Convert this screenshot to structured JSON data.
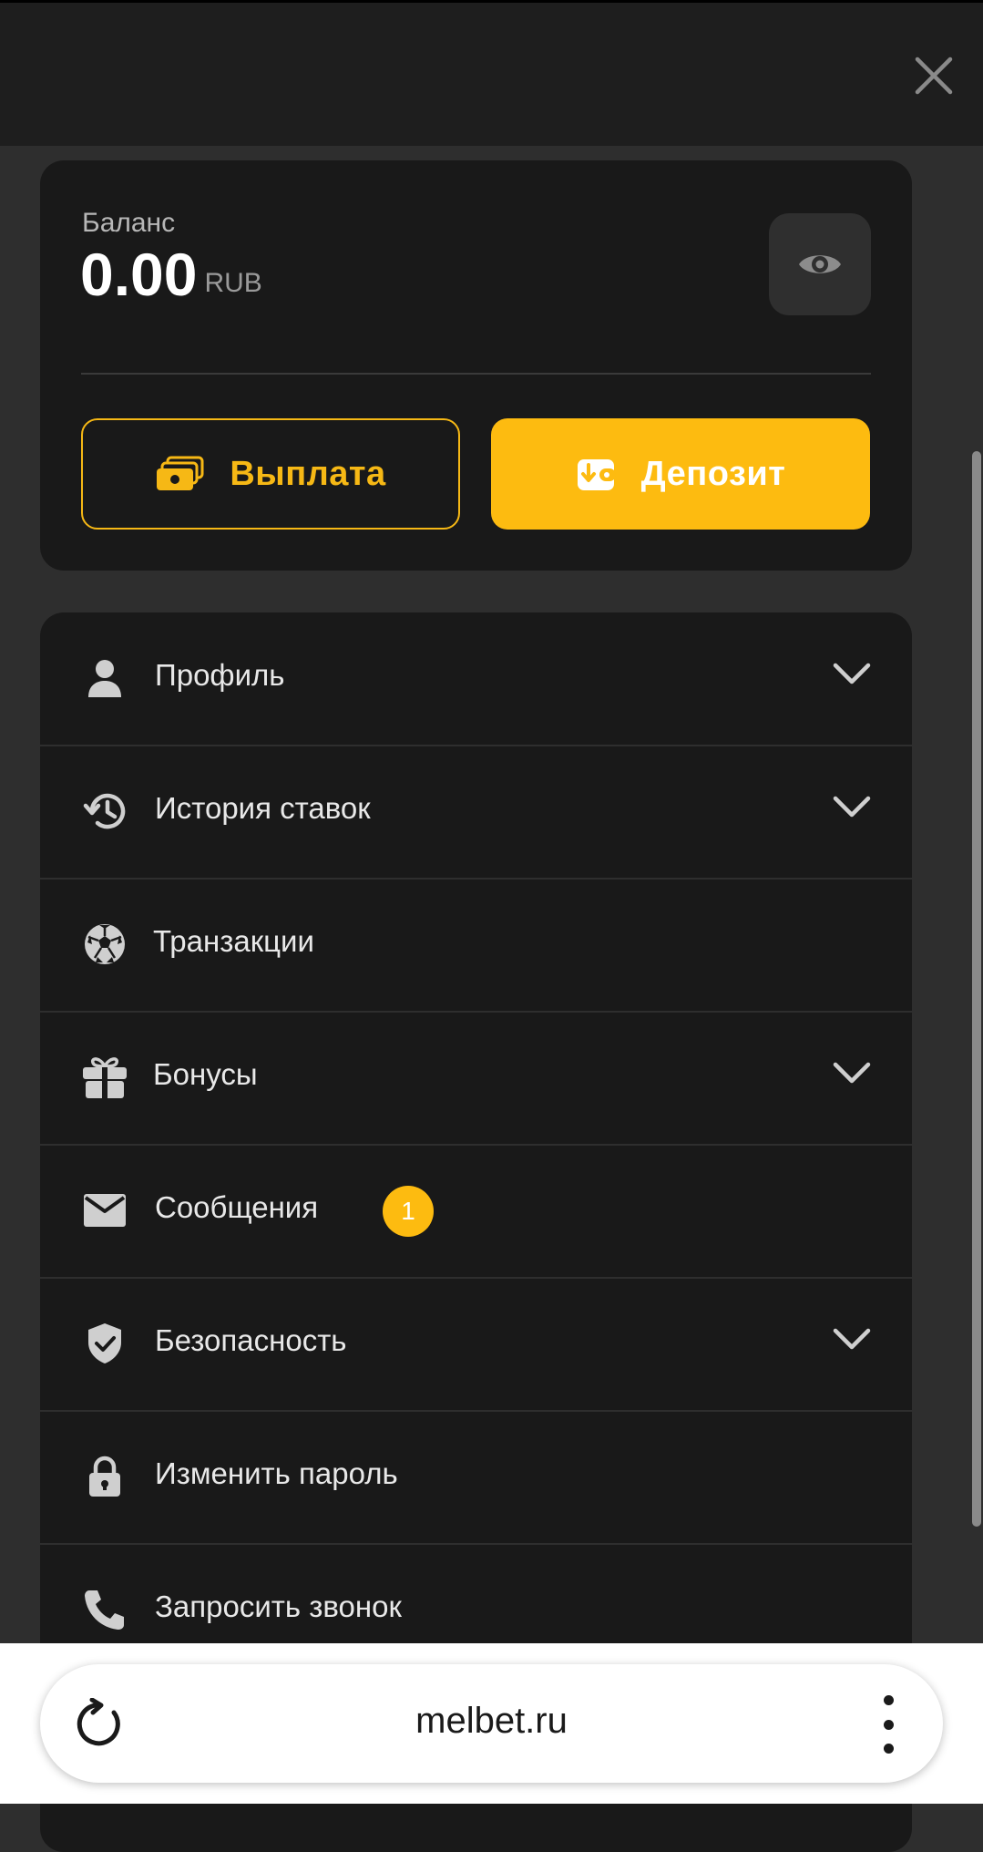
{
  "header": {
    "close_icon": "close-icon"
  },
  "balance": {
    "label": "Баланс",
    "amount": "0.00",
    "currency": "RUB",
    "visibility_icon": "eye-icon"
  },
  "actions": {
    "payout_label": "Выплата",
    "payout_icon": "cash-icon",
    "deposit_label": "Депозит",
    "deposit_icon": "wallet-icon"
  },
  "menu": {
    "items": [
      {
        "label": "Профиль",
        "icon": "user-icon",
        "expandable": true
      },
      {
        "label": "История ставок",
        "icon": "history-icon",
        "expandable": true
      },
      {
        "label": "Транзакции",
        "icon": "soccer-ball-icon",
        "expandable": false
      },
      {
        "label": "Бонусы",
        "icon": "gift-icon",
        "expandable": true
      },
      {
        "label": "Сообщения",
        "icon": "mail-icon",
        "expandable": false,
        "badge": "1"
      },
      {
        "label": "Безопасность",
        "icon": "shield-icon",
        "expandable": true
      },
      {
        "label": "Изменить пароль",
        "icon": "lock-icon",
        "expandable": false
      },
      {
        "label": "Запросить звонок",
        "icon": "phone-icon",
        "expandable": false
      }
    ]
  },
  "browser": {
    "url": "melbet.ru",
    "reload_icon": "reload-icon",
    "more_icon": "more-vertical-icon"
  },
  "colors": {
    "accent": "#fdbb10",
    "background": "#2e2e2e",
    "card": "#191919",
    "header": "#1e1e1e"
  }
}
